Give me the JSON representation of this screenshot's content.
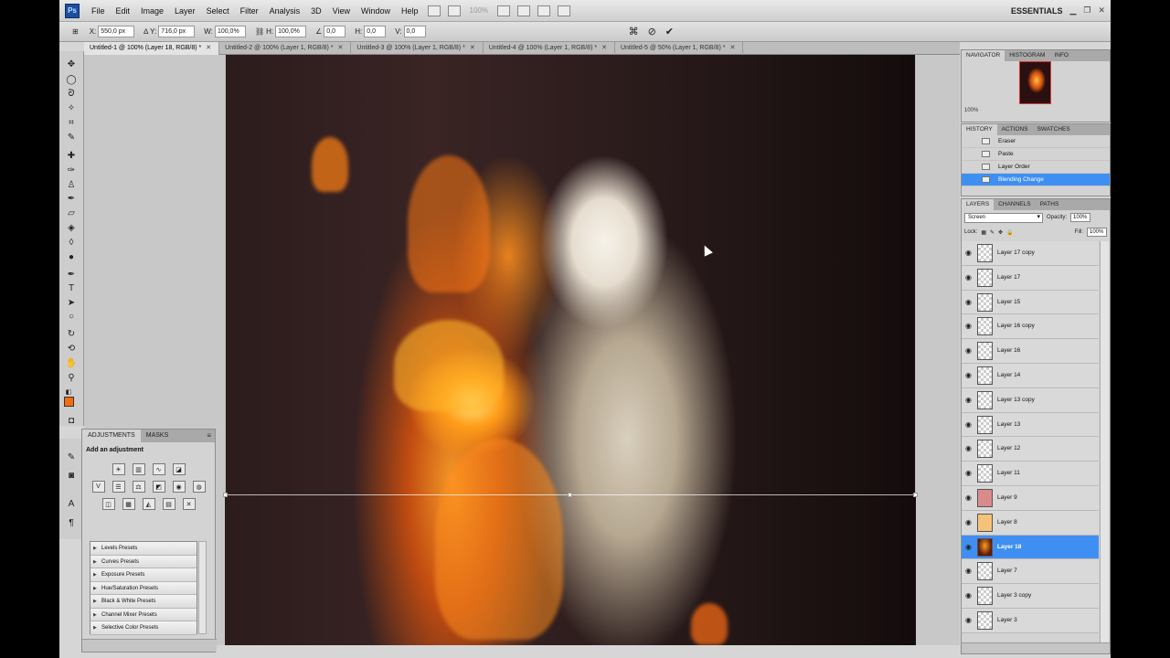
{
  "app": {
    "logo": "Ps",
    "workspace": "ESSENTIALS",
    "zoom_placeholder": "100%"
  },
  "menu": [
    "File",
    "Edit",
    "Image",
    "Layer",
    "Select",
    "Filter",
    "Analysis",
    "3D",
    "View",
    "Window",
    "Help"
  ],
  "options": {
    "x_label": "X:",
    "x_value": "550,0 px",
    "y_label": "Y:",
    "y_value": "716,0 px",
    "w_label": "W:",
    "w_value": "100,0%",
    "h_label": "H:",
    "h_value": "100,0%",
    "angle_value": "0,0",
    "hskew_label": "H:",
    "hskew_value": "0,0",
    "vskew_label": "V:",
    "vskew_value": "0,0",
    "cancel_icon": "cancel-icon",
    "commit_icon": "checkmark-icon"
  },
  "tabs": [
    {
      "label": "Untitled-1 @ 100% (Layer 18, RGB/8) *",
      "active": true
    },
    {
      "label": "Untitled-2 @ 100% (Layer 1, RGB/8) *",
      "active": false
    },
    {
      "label": "Untitled-3 @ 100% (Layer 1, RGB/8) *",
      "active": false
    },
    {
      "label": "Untitled-4 @ 100% (Layer 1, RGB/8) *",
      "active": false
    },
    {
      "label": "Untitled-5 @ 50% (Layer 1, RGB/8) *",
      "active": false
    }
  ],
  "adjustments": {
    "tabs": [
      "ADJUSTMENTS",
      "MASKS"
    ],
    "title": "Add an adjustment",
    "presets": [
      "Levels Presets",
      "Curves Presets",
      "Exposure Presets",
      "Hue/Saturation Presets",
      "Black & White Presets",
      "Channel Mixer Presets",
      "Selective Color Presets"
    ]
  },
  "navigator": {
    "tabs": [
      "NAVIGATOR",
      "HISTOGRAM",
      "INFO"
    ],
    "zoom": "100%"
  },
  "history": {
    "tabs": [
      "HISTORY",
      "ACTIONS",
      "SWATCHES"
    ],
    "items": [
      {
        "label": "Eraser",
        "active": false
      },
      {
        "label": "Paste",
        "active": false
      },
      {
        "label": "Layer Order",
        "active": false
      },
      {
        "label": "Blending Change",
        "active": true
      }
    ]
  },
  "layers": {
    "tabs": [
      "LAYERS",
      "CHANNELS",
      "PATHS"
    ],
    "blend_mode": "Screen",
    "opacity_label": "Opacity:",
    "opacity": "100%",
    "lock_label": "Lock:",
    "fill_label": "Fill:",
    "fill": "100%",
    "items": [
      {
        "name": "Layer 17 copy",
        "active": false
      },
      {
        "name": "Layer 17",
        "active": false
      },
      {
        "name": "Layer 15",
        "active": false
      },
      {
        "name": "Layer 16 copy",
        "active": false
      },
      {
        "name": "Layer 16",
        "active": false
      },
      {
        "name": "Layer 14",
        "active": false
      },
      {
        "name": "Layer 13 copy",
        "active": false
      },
      {
        "name": "Layer 13",
        "active": false
      },
      {
        "name": "Layer 12",
        "active": false
      },
      {
        "name": "Layer 11",
        "active": false
      },
      {
        "name": "Layer 9",
        "active": false
      },
      {
        "name": "Layer 8",
        "active": false
      },
      {
        "name": "Layer 18",
        "active": true
      },
      {
        "name": "Layer 7",
        "active": false
      },
      {
        "name": "Layer 3 copy",
        "active": false
      },
      {
        "name": "Layer 3",
        "active": false
      }
    ]
  },
  "colors": {
    "foreground": "#f26d12",
    "selection": "#3f8ff2"
  }
}
